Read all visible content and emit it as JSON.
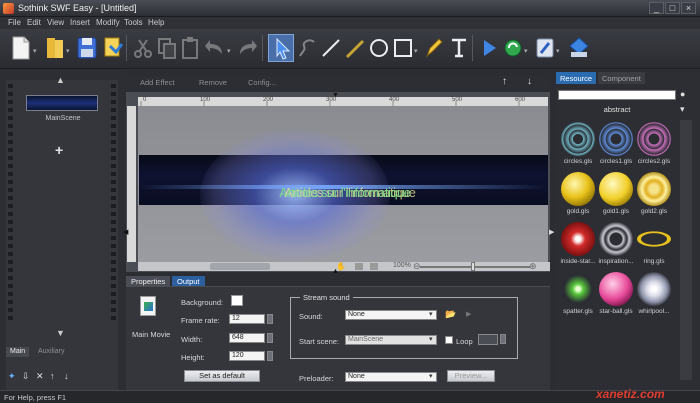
{
  "window": {
    "title": "Sothink SWF Easy - [Untitled]",
    "minimize": "_",
    "maximize": "□",
    "close": "×"
  },
  "menu": [
    "File",
    "Edit",
    "View",
    "Insert",
    "Modify",
    "Tools",
    "Help"
  ],
  "toolbar_icons": [
    "new-file-icon",
    "open-file-icon",
    "save-icon",
    "publish-icon",
    "cut-icon",
    "copy-icon",
    "paste-icon",
    "undo-icon",
    "redo-icon",
    "move-icon",
    "select-arrow-icon",
    "lasso-icon",
    "line-icon",
    "ellipse-icon",
    "rectangle-icon",
    "pen-icon",
    "text-icon",
    "play-icon",
    "refresh-icon",
    "wizard-icon",
    "export-icon"
  ],
  "left_panel": {
    "scene_name": "MainScene",
    "add_symbol": "+",
    "tabs": [
      "Main",
      "Auxiliary"
    ],
    "up": "▲",
    "down": "▼"
  },
  "effect_bar": {
    "add_effect": "Add Effect",
    "remove": "Remove",
    "config": "Config..."
  },
  "stage": {
    "title_text": "Articles sur l'informatique",
    "ruler_marks": [
      "0",
      "100",
      "200",
      "300",
      "400",
      "500",
      "600",
      "700",
      "800"
    ],
    "zoom": "100%"
  },
  "resource_panel": {
    "tabs": [
      "Resource",
      "Component"
    ],
    "category": "abstract",
    "items": [
      {
        "label": "circles.gls",
        "color": "#6fb6c4"
      },
      {
        "label": "circles1.gls",
        "color": "#5f8fe0"
      },
      {
        "label": "circles2.gls",
        "color": "#d070c0"
      },
      {
        "label": "gold.gls",
        "color": "#e8c21a"
      },
      {
        "label": "gold1.gls",
        "color": "#f1cf28"
      },
      {
        "label": "gold2.gls",
        "color": "#e0b020"
      },
      {
        "label": "inside-star...",
        "color": "#d22a2a"
      },
      {
        "label": "inspiration...",
        "color": "#c9c9d2"
      },
      {
        "label": "ring.gls",
        "color": "#e8c11d"
      },
      {
        "label": "spatter.gls",
        "color": "#58c83c"
      },
      {
        "label": "star-ball.gls",
        "color": "#e84a9a"
      },
      {
        "label": "whirlpool...",
        "color": "#d9dbe8"
      }
    ]
  },
  "properties": {
    "tabs": [
      "Properties",
      "Output"
    ],
    "object": "Main Movie",
    "background_label": "Background:",
    "frame_rate_label": "Frame rate:",
    "frame_rate": "12",
    "width_label": "Width:",
    "width": "648",
    "height_label": "Height:",
    "height": "120",
    "set_default": "Set as default",
    "stream_sound": "Stream sound",
    "sound_label": "Sound:",
    "sound": "None",
    "start_scene_label": "Start scene:",
    "start_scene": "MainScene",
    "loop_label": "Loop",
    "preloader_label": "Preloader:",
    "preloader": "None",
    "preview": "Preview..."
  },
  "status": {
    "text": "For Help, press F1"
  },
  "watermark": "xanetiz.com"
}
